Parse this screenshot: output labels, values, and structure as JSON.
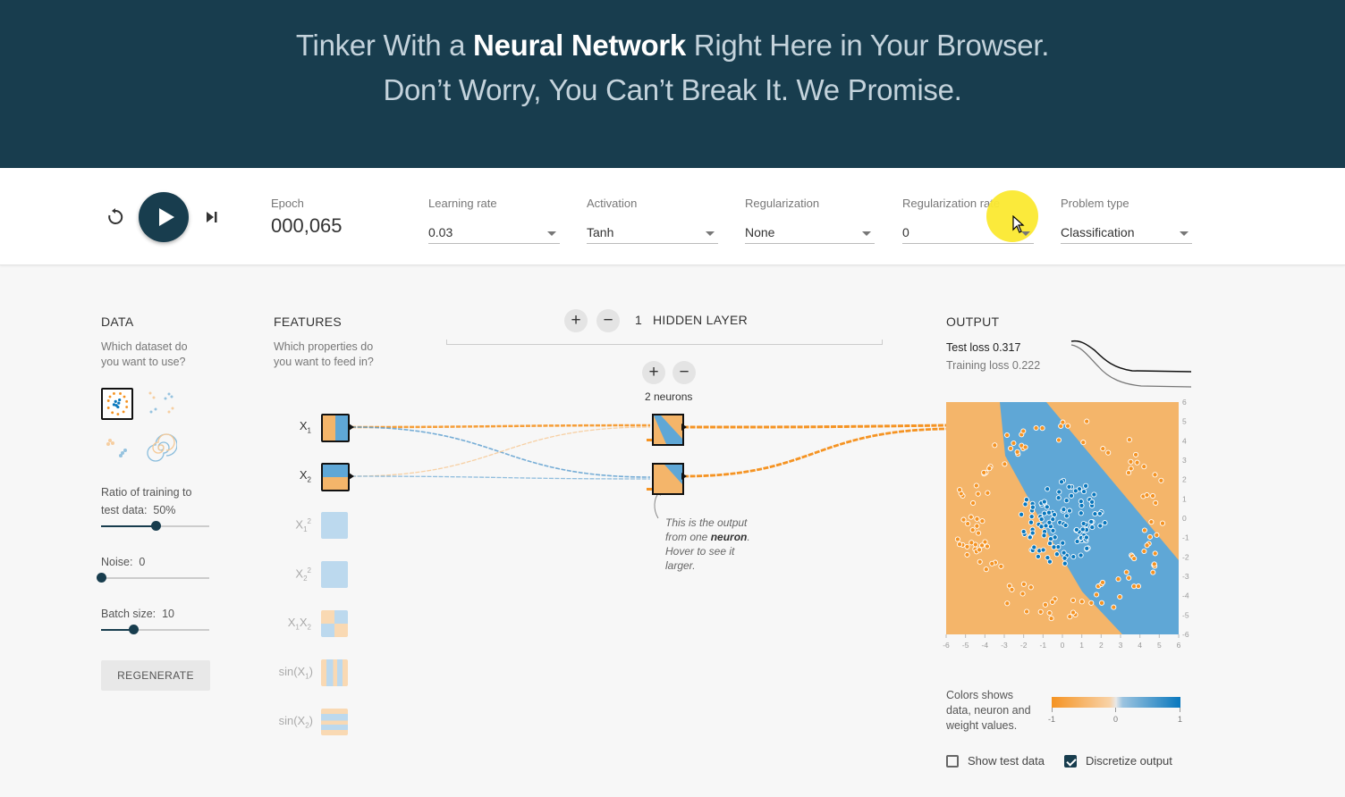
{
  "header": {
    "line1_pre": "Tinker With a ",
    "line1_bold": "Neural Network",
    "line1_post": " Right Here in Your Browser.",
    "line2": "Don’t Worry, You Can’t Break It. We Promise."
  },
  "controls": {
    "epoch_label": "Epoch",
    "epoch_value": "000,065",
    "learning_rate": {
      "label": "Learning rate",
      "value": "0.03"
    },
    "activation": {
      "label": "Activation",
      "value": "Tanh"
    },
    "regularization": {
      "label": "Regularization",
      "value": "None"
    },
    "regularization_rate": {
      "label": "Regularization rate",
      "value": "0"
    },
    "problem_type": {
      "label": "Problem type",
      "value": "Classification"
    }
  },
  "data_panel": {
    "title": "DATA",
    "subtitle_1": "Which dataset do",
    "subtitle_2": "you want to use?",
    "ratio_label_1": "Ratio of training to",
    "ratio_label_2": "test data:",
    "ratio_value": "50%",
    "ratio_fraction": 0.5,
    "noise_label": "Noise:",
    "noise_value": "0",
    "noise_fraction": 0,
    "batch_label": "Batch size:",
    "batch_value": "10",
    "batch_fraction": 0.3,
    "regenerate": "REGENERATE"
  },
  "features_panel": {
    "title": "FEATURES",
    "subtitle_1": "Which properties do",
    "subtitle_2": "you want to feed in?"
  },
  "network": {
    "hidden_layers_count": "1",
    "hidden_layers_label": "HIDDEN LAYER",
    "neurons_label": "2 neurons",
    "note_1": "This is the output from one",
    "note_bold": "neuron",
    "note_2": ". Hover to see it larger."
  },
  "output_panel": {
    "title": "OUTPUT",
    "test_loss_label": "Test loss",
    "test_loss_value": "0.317",
    "training_loss_label": "Training loss",
    "training_loss_value": "0.222",
    "axis_ticks": [
      "-6",
      "-5",
      "-4",
      "-3",
      "-2",
      "-1",
      "0",
      "1",
      "2",
      "3",
      "4",
      "5",
      "6"
    ],
    "legend_text_1": "Colors shows",
    "legend_text_2": "data, neuron and",
    "legend_text_3": "weight values.",
    "legend_min": "-1",
    "legend_mid": "0",
    "legend_max": "1",
    "show_test_data": "Show test data",
    "discretize_output": "Discretize output"
  },
  "colors": {
    "header_bg": "#183d4e",
    "orange": "#f59322",
    "blue": "#0877bd",
    "region_orange": "#f4b56a",
    "region_blue": "#5fa7d6"
  }
}
